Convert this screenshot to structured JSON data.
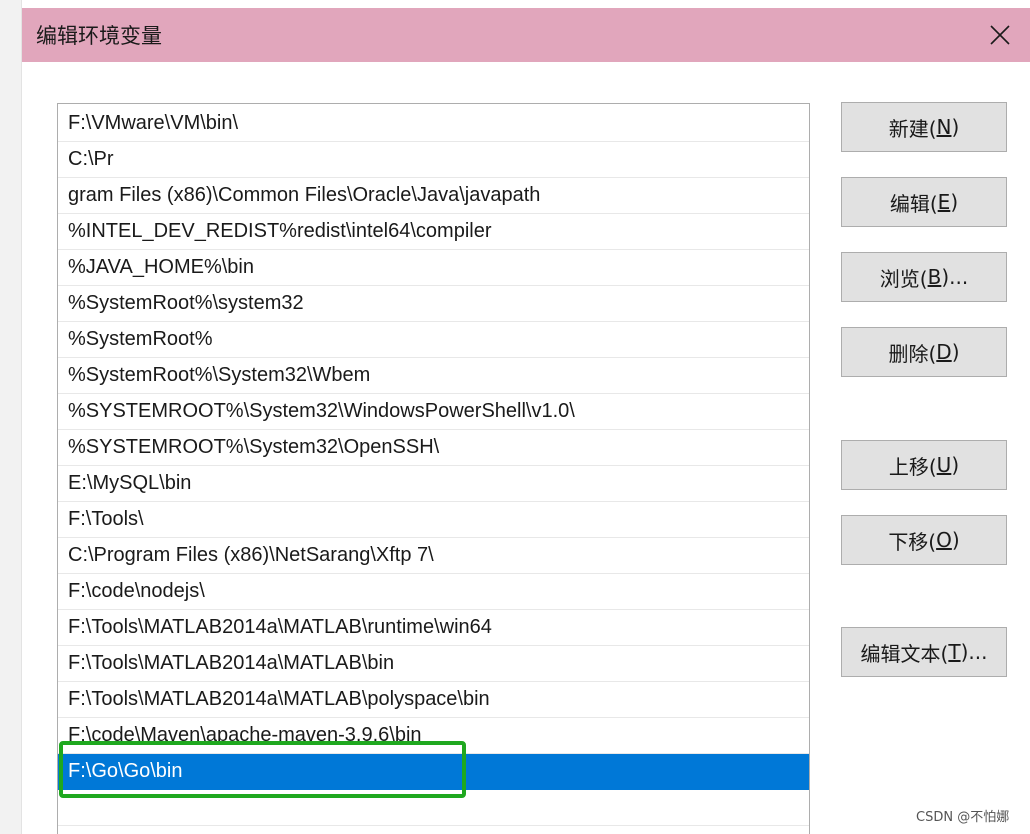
{
  "window": {
    "title": "编辑环境变量",
    "close_icon": "close-icon"
  },
  "list": {
    "items": [
      "F:\\VMware\\VM\\bin\\",
      "C:\\Pr",
      "gram Files (x86)\\Common Files\\Oracle\\Java\\javapath",
      "%INTEL_DEV_REDIST%redist\\intel64\\compiler",
      "%JAVA_HOME%\\bin",
      "%SystemRoot%\\system32",
      "%SystemRoot%",
      "%SystemRoot%\\System32\\Wbem",
      "%SYSTEMROOT%\\System32\\WindowsPowerShell\\v1.0\\",
      "%SYSTEMROOT%\\System32\\OpenSSH\\",
      "E:\\MySQL\\bin",
      "F:\\Tools\\",
      "C:\\Program Files (x86)\\NetSarang\\Xftp 7\\",
      "F:\\code\\nodejs\\",
      "F:\\Tools\\MATLAB2014a\\MATLAB\\runtime\\win64",
      "F:\\Tools\\MATLAB2014a\\MATLAB\\bin",
      "F:\\Tools\\MATLAB2014a\\MATLAB\\polyspace\\bin",
      "F:\\code\\Maven\\apache-maven-3.9.6\\bin",
      "F:\\Go\\Go\\bin"
    ],
    "selected_index": 18
  },
  "buttons": {
    "new": {
      "pre": "新建(",
      "key": "N",
      "post": ")"
    },
    "edit": {
      "pre": "编辑(",
      "key": "E",
      "post": ")"
    },
    "browse": {
      "pre": "浏览(",
      "key": "B",
      "post": ")..."
    },
    "delete": {
      "pre": "删除(",
      "key": "D",
      "post": ")"
    },
    "move_up": {
      "pre": "上移(",
      "key": "U",
      "post": ")"
    },
    "move_down": {
      "pre": "下移(",
      "key": "O",
      "post": ")"
    },
    "edit_text": {
      "pre": "编辑文本(",
      "key": "T",
      "post": ")..."
    }
  },
  "watermark": "CSDN @不怕娜",
  "colors": {
    "titlebar": "#e1a6bc",
    "selection": "#0078d7",
    "highlight_box": "#1fa81f"
  }
}
